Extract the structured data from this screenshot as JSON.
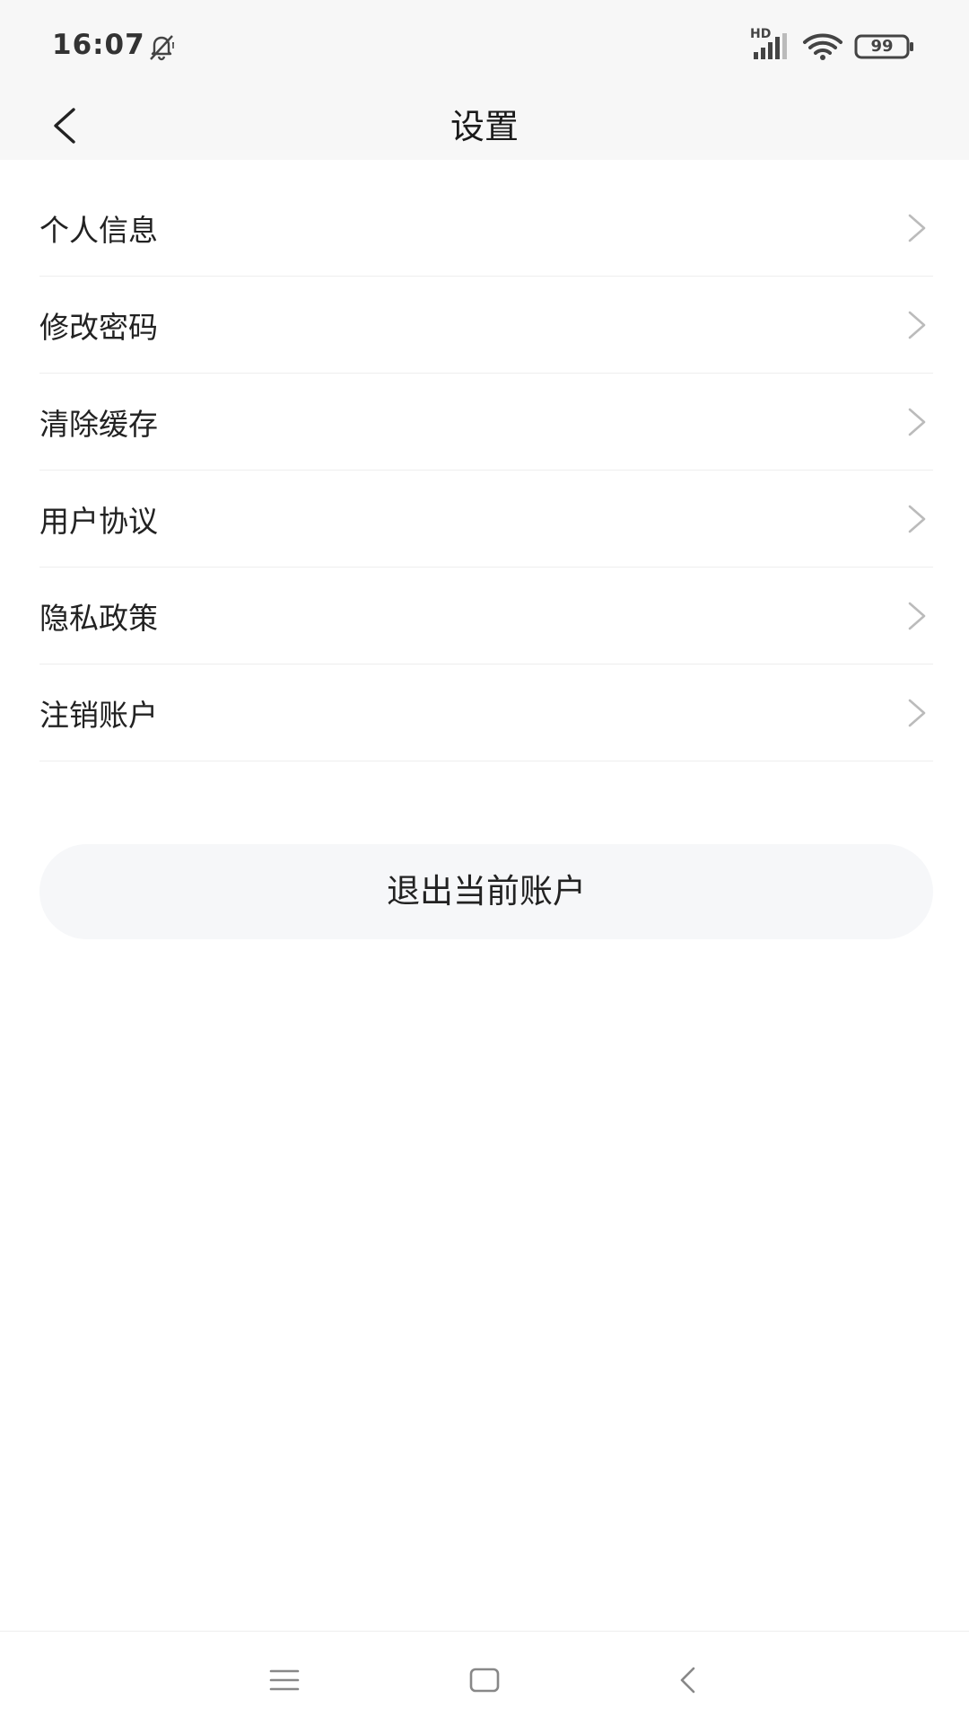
{
  "status_bar": {
    "time": "16:07",
    "signal_label": "HD",
    "battery_level": "99",
    "icons": [
      "notification-mute-icon",
      "signal-icon",
      "wifi-icon",
      "battery-icon"
    ]
  },
  "header": {
    "title": "设置",
    "back_icon": "chevron-left-icon"
  },
  "settings": {
    "items": [
      {
        "label": "个人信息"
      },
      {
        "label": "修改密码"
      },
      {
        "label": "清除缓存"
      },
      {
        "label": "用户协议"
      },
      {
        "label": "隐私政策"
      },
      {
        "label": "注销账户"
      }
    ]
  },
  "logout": {
    "label": "退出当前账户"
  },
  "system_nav": {
    "icons": [
      "menu-icon",
      "home-icon",
      "back-icon"
    ]
  },
  "colors": {
    "header_bg": "#f7f7f7",
    "divider": "#eeeeee",
    "chevron": "#bbbbbb",
    "button_bg": "#f6f7f9",
    "text": "#222222"
  }
}
